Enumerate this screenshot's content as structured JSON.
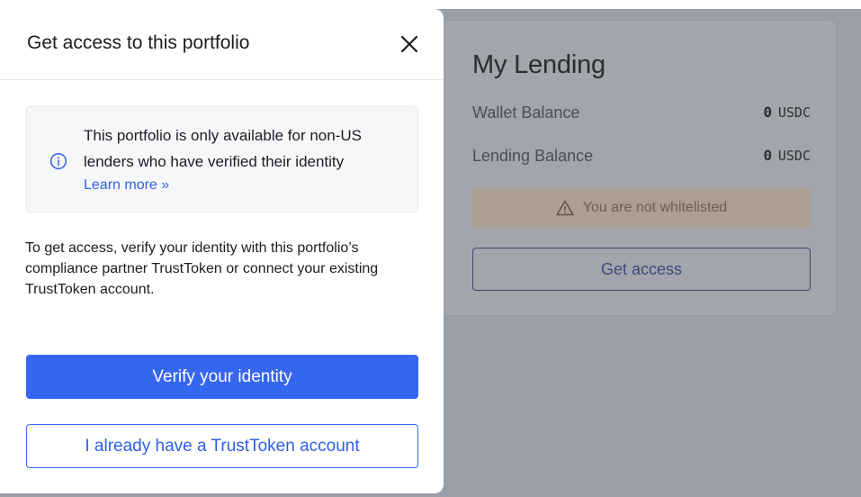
{
  "background": {
    "lending": {
      "title": "My Lending",
      "rows": [
        {
          "label": "Wallet Balance",
          "value": "0",
          "unit": "USDC"
        },
        {
          "label": "Lending Balance",
          "value": "0",
          "unit": "USDC"
        }
      ],
      "warning": "You are not whitelisted",
      "warning_icon": "warning-triangle-icon",
      "get_access_label": "Get access"
    }
  },
  "modal": {
    "title": "Get access to this portfolio",
    "close_icon": "close-icon",
    "info": {
      "icon": "info-icon",
      "text": "This portfolio is only available for non-US lenders who have verified their identity",
      "link": "Learn more »"
    },
    "description": "To get access, verify your identity with this portfolio’s compliance partner TrustToken or connect your existing TrustToken account.",
    "primary_button": "Verify your identity",
    "secondary_button": "I already have a TrustToken account"
  },
  "colors": {
    "primary": "#3566ef",
    "link": "#2f5fe8",
    "overlay": "#9a9ea6"
  }
}
